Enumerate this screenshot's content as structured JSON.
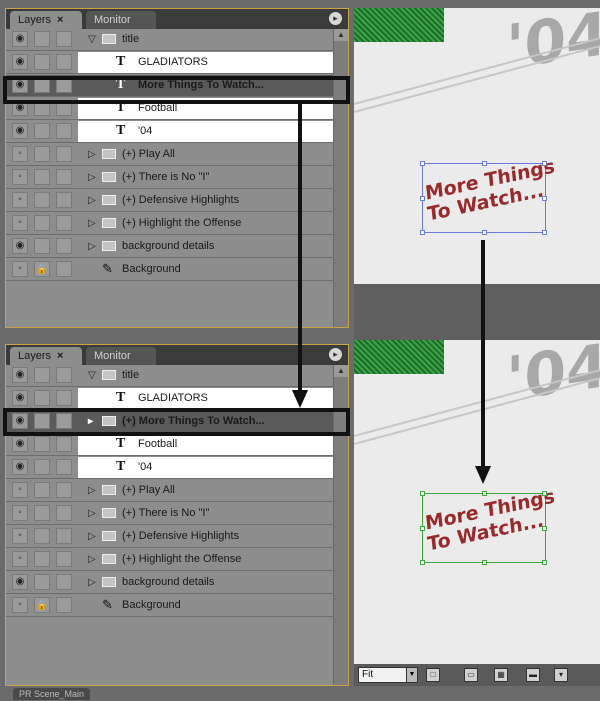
{
  "panels": {
    "tab_layers": "Layers",
    "tab_monitor": "Monitor"
  },
  "top_layers": [
    {
      "name": "title",
      "kind": "folder-open"
    },
    {
      "name": "GLADIATORS",
      "kind": "text"
    },
    {
      "name": "More Things To Watch...",
      "kind": "text",
      "selected": true
    },
    {
      "name": "Football",
      "kind": "text"
    },
    {
      "name": "'04",
      "kind": "text"
    },
    {
      "name": "(+) Play All",
      "kind": "folder"
    },
    {
      "name": "(+) There is No \"I\"",
      "kind": "folder"
    },
    {
      "name": "(+) Defensive Highlights",
      "kind": "folder"
    },
    {
      "name": "(+) Highlight the Offense",
      "kind": "folder"
    },
    {
      "name": "background details",
      "kind": "folder"
    },
    {
      "name": "Background",
      "kind": "image"
    }
  ],
  "bottom_layers": [
    {
      "name": "title",
      "kind": "folder-open"
    },
    {
      "name": "GLADIATORS",
      "kind": "text"
    },
    {
      "name": "(+) More Things To Watch...",
      "kind": "folder",
      "selected": true
    },
    {
      "name": "Football",
      "kind": "text"
    },
    {
      "name": "'04",
      "kind": "text"
    },
    {
      "name": "(+) Play All",
      "kind": "folder"
    },
    {
      "name": "(+) There is No \"I\"",
      "kind": "folder"
    },
    {
      "name": "(+) Defensive Highlights",
      "kind": "folder"
    },
    {
      "name": "(+) Highlight the Offense",
      "kind": "folder"
    },
    {
      "name": "background details",
      "kind": "folder"
    },
    {
      "name": "Background",
      "kind": "image"
    }
  ],
  "comp": {
    "graphic_text_line1": "More Things",
    "graphic_text_line2": "To Watch...",
    "year_text": "'04",
    "top_box_color": "#6a7ad8",
    "bottom_box_color": "#3aaa3a"
  },
  "viewer": {
    "zoom": "Fit"
  },
  "footer": {
    "tab": "PR Scene_Main"
  },
  "icons": {
    "eye": "eye-icon",
    "lock": "lock-icon",
    "text_layer": "text-layer-icon",
    "folder": "folder-icon",
    "brush": "brush-icon"
  }
}
